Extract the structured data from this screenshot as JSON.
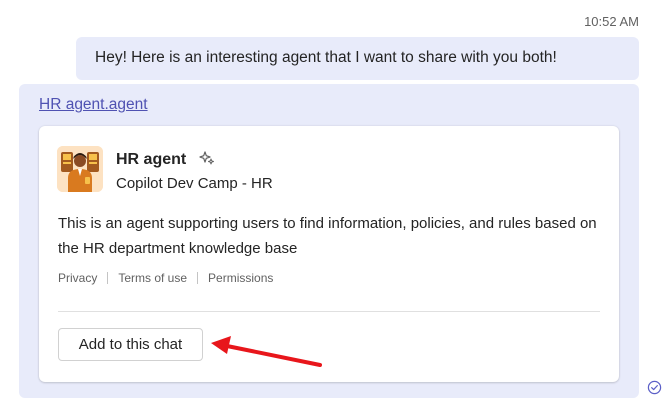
{
  "timestamp": "10:52 AM",
  "sent_message": {
    "text": "Hey! Here is an interesting agent that I want to share with you both!"
  },
  "received_message": {
    "link_text": "HR agent.agent",
    "card": {
      "agent_name": "HR agent",
      "agent_icon": "agent-avatar-icon",
      "badge_icon": "sparkle-icon",
      "publisher": "Copilot Dev Camp - HR",
      "description": "This is an agent supporting users to find information, policies, and rules based on the HR department knowledge base",
      "links": {
        "privacy": "Privacy",
        "terms": "Terms of use",
        "permissions": "Permissions"
      },
      "add_button_label": "Add to this chat"
    }
  },
  "colors": {
    "bubble_bg": "#e8ebfa",
    "link": "#4f52b2",
    "annotation_arrow": "#e8161b",
    "read_receipt": "#5b5fc7"
  },
  "icons": {
    "annotation": "red-arrow-icon",
    "status": "read-receipt-icon"
  }
}
